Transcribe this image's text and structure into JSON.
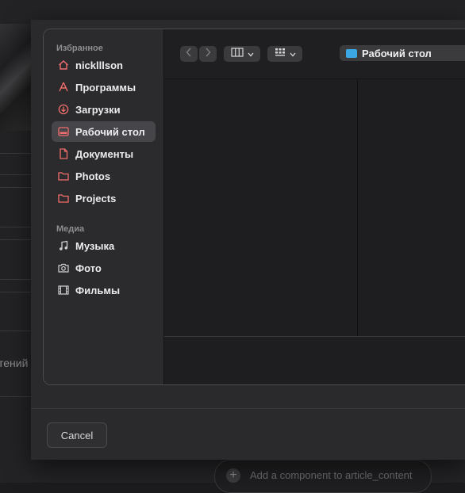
{
  "background": {
    "partial_label": "тений",
    "add_component": "Add a component to article_content"
  },
  "sidebar": {
    "favorites_title": "Избранное",
    "favorites": [
      {
        "label": "nicklllson",
        "icon": "home-icon"
      },
      {
        "label": "Программы",
        "icon": "applications-icon"
      },
      {
        "label": "Загрузки",
        "icon": "downloads-icon"
      },
      {
        "label": "Рабочий стол",
        "icon": "desktop-icon",
        "active": true
      },
      {
        "label": "Документы",
        "icon": "document-icon"
      },
      {
        "label": "Photos",
        "icon": "folder-icon"
      },
      {
        "label": "Projects",
        "icon": "folder-icon"
      }
    ],
    "media_title": "Медиа",
    "media": [
      {
        "label": "Музыка",
        "icon": "music-icon"
      },
      {
        "label": "Фото",
        "icon": "camera-icon"
      },
      {
        "label": "Фильмы",
        "icon": "film-icon"
      }
    ]
  },
  "toolbar": {
    "location": "Рабочий стол",
    "accent": "#3ba7e5",
    "icon_color": "#f26d6d"
  },
  "footer": {
    "cancel_label": "Cancel"
  }
}
